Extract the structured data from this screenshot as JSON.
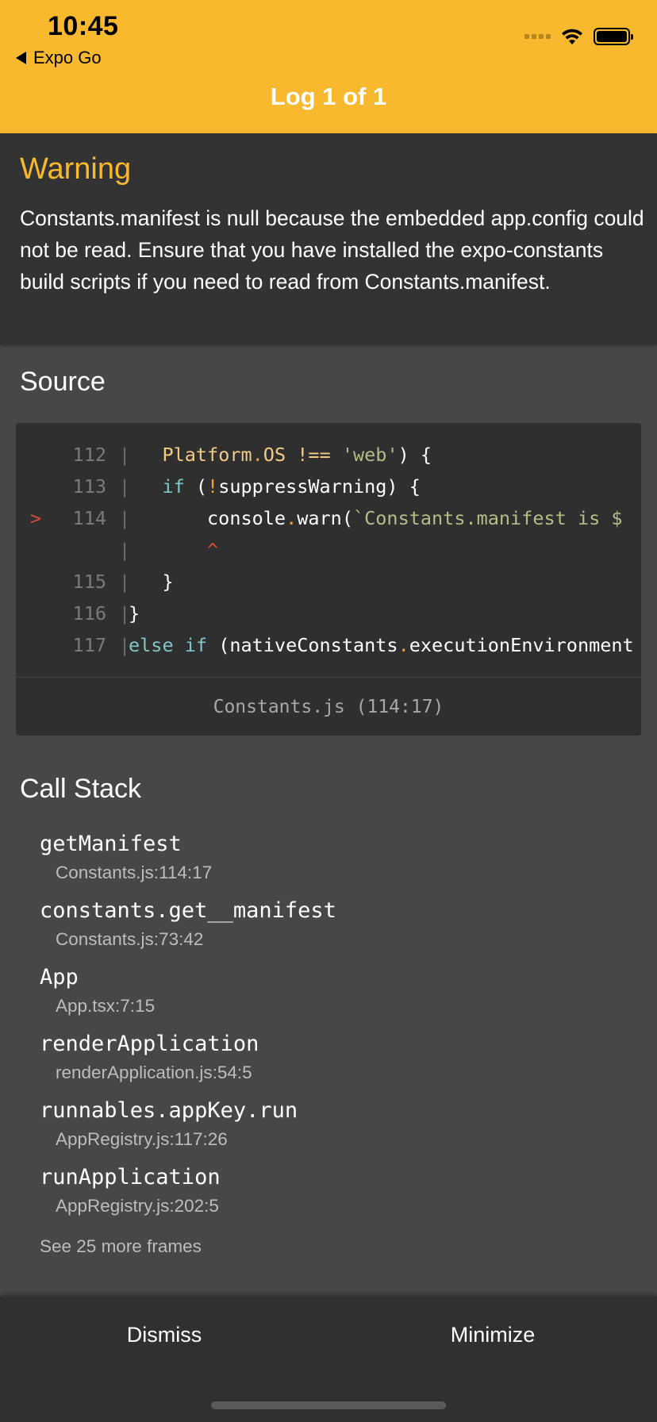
{
  "status_bar": {
    "time": "10:45",
    "back_label": "Expo Go"
  },
  "header": {
    "title": "Log 1 of 1"
  },
  "warning": {
    "level": "Warning",
    "message": "Constants.manifest is null because the embedded app.config could not be read. Ensure that you have installed the expo-constants build scripts if you need to read from Constants.manifest."
  },
  "source": {
    "heading": "Source",
    "lines": [
      {
        "marker": "",
        "num": "112",
        "bar": "|",
        "segments": [
          [
            "",
            "   "
          ],
          [
            "prop",
            "Platform"
          ],
          [
            "dot",
            "."
          ],
          [
            "prop",
            "OS"
          ],
          [
            "",
            " "
          ],
          [
            "prop",
            "!=="
          ],
          [
            "",
            " "
          ],
          [
            "str",
            "'web'"
          ],
          [
            "",
            ") {"
          ]
        ]
      },
      {
        "marker": "",
        "num": "113",
        "bar": "|",
        "segments": [
          [
            "",
            "   "
          ],
          [
            "kw",
            "if"
          ],
          [
            "",
            " ("
          ],
          [
            "dot",
            "!"
          ],
          [
            "",
            "suppressWarning) {"
          ]
        ]
      },
      {
        "marker": ">",
        "num": "114",
        "bar": "|",
        "segments": [
          [
            "",
            "       console"
          ],
          [
            "dot",
            "."
          ],
          [
            "",
            "warn("
          ],
          [
            "str",
            "`Constants.manifest is $"
          ]
        ]
      },
      {
        "marker": "",
        "num": "",
        "bar": "|",
        "segments": [
          [
            "",
            "       "
          ],
          [
            "err",
            "^"
          ]
        ]
      },
      {
        "marker": "",
        "num": "115",
        "bar": "|",
        "segments": [
          [
            "",
            "   }"
          ]
        ]
      },
      {
        "marker": "",
        "num": "116",
        "bar": "|",
        "segments": [
          [
            "",
            "}"
          ]
        ]
      },
      {
        "marker": "",
        "num": "117",
        "bar": "|",
        "segments": [
          [
            "kw",
            "else"
          ],
          [
            "",
            " "
          ],
          [
            "kw",
            "if"
          ],
          [
            "",
            " (nativeConstants"
          ],
          [
            "dot",
            "."
          ],
          [
            "",
            "executionEnvironment"
          ]
        ]
      }
    ],
    "file_ref": "Constants.js (114:17)"
  },
  "call_stack": {
    "heading": "Call Stack",
    "frames": [
      {
        "fn": "getManifest",
        "loc": "Constants.js:114:17"
      },
      {
        "fn": "constants.get__manifest",
        "loc": "Constants.js:73:42"
      },
      {
        "fn": "App",
        "loc": "App.tsx:7:15"
      },
      {
        "fn": "renderApplication",
        "loc": "renderApplication.js:54:5"
      },
      {
        "fn": "runnables.appKey.run",
        "loc": "AppRegistry.js:117:26"
      },
      {
        "fn": "runApplication",
        "loc": "AppRegistry.js:202:5"
      }
    ],
    "more_frames": "See 25 more frames"
  },
  "footer": {
    "dismiss_label": "Dismiss",
    "minimize_label": "Minimize"
  },
  "colors": {
    "accent": "#f9b92f",
    "panel": "#333333",
    "background": "#474747",
    "code_background": "#2f2f2f"
  }
}
